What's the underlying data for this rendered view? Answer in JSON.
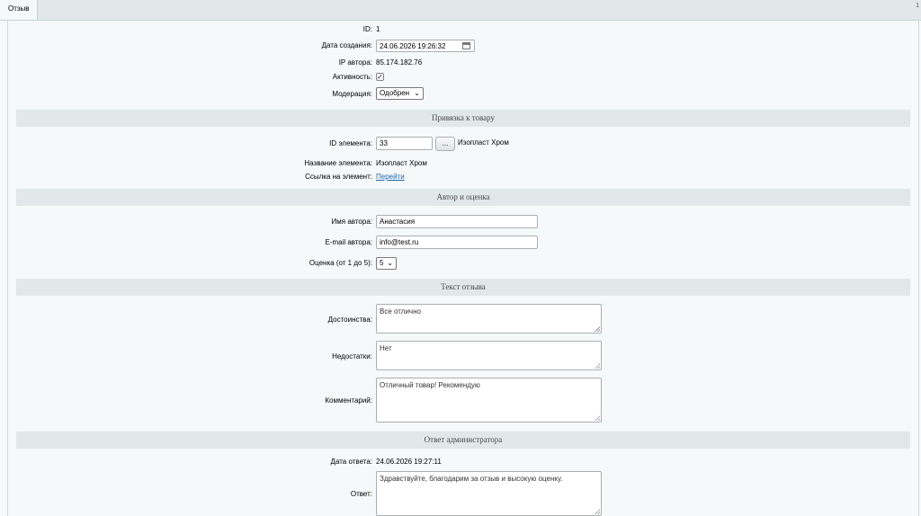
{
  "tab": {
    "label": "Отзыв"
  },
  "corner": "1",
  "fields": {
    "id": {
      "label": "ID:",
      "value": "1"
    },
    "created": {
      "label": "Дата создания:",
      "value": "24.06.2026 19:26:32"
    },
    "ip": {
      "label": "IP автора:",
      "value": "85.174.182.76"
    },
    "active": {
      "label": "Активность:",
      "checked": true
    },
    "moderation": {
      "label": "Модерация:",
      "value": "Одобрен"
    }
  },
  "sections": {
    "product": "Привязка к товару",
    "author": "Автор и оценка",
    "text": "Текст отзыва",
    "admin": "Ответ администратора"
  },
  "product": {
    "element_id_label": "ID элемента:",
    "element_id_value": "33",
    "browse_label": "...",
    "element_hint": "Изопласт Хром",
    "name_label": "Название элемента:",
    "name_value": "Изопласт Хром",
    "link_label": "Ссылка на элемент:",
    "link_text": "Перейти"
  },
  "author": {
    "name_label": "Имя автора:",
    "name_value": "Анастасия",
    "email_label": "E-mail автора:",
    "email_value": "info@test.ru",
    "rating_label": "Оценка (от 1 до 5):",
    "rating_value": "5"
  },
  "review": {
    "pros_label": "Достоинства:",
    "pros_value": "Все отлично",
    "cons_label": "Недостатки:",
    "cons_value": "Нет",
    "comment_label": "Комментарий:",
    "comment_value": "Отличный товар! Рекомендую"
  },
  "admin": {
    "date_label": "Дата ответа:",
    "date_value": "24.06.2026 19:27:11",
    "answer_label": "Ответ:",
    "answer_value": "Здравствуйте, благодарим за отзыв и высокую оценку."
  },
  "icons": {
    "calendar": "calendar-icon",
    "check": "✓",
    "chevron": "⌄"
  }
}
